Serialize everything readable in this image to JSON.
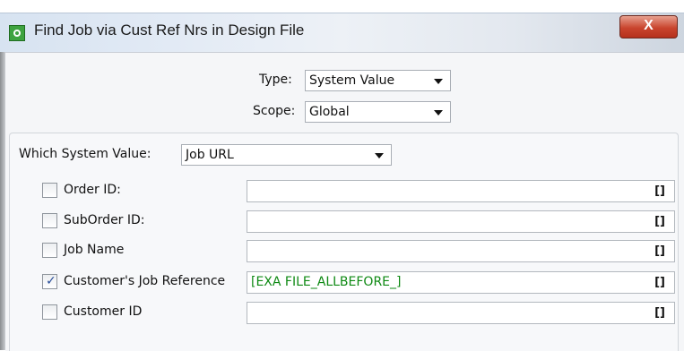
{
  "window": {
    "title": "Find Job via Cust Ref Nrs in Design File",
    "close_label": "X"
  },
  "type": {
    "label": "Type:",
    "value": "System Value"
  },
  "scope": {
    "label": "Scope:",
    "value": "Global"
  },
  "system_value": {
    "label": "Which System Value:",
    "value": "Job URL"
  },
  "fields": [
    {
      "label": "Order ID:",
      "checked": false,
      "value": "",
      "suffix": "[]"
    },
    {
      "label": "SubOrder ID:",
      "checked": false,
      "value": "",
      "suffix": "[]"
    },
    {
      "label": "Job Name",
      "checked": false,
      "value": "",
      "suffix": "[]"
    },
    {
      "label": "Customer's Job Reference",
      "checked": true,
      "value": "[EXA FILE_ALLBEFORE_]",
      "suffix": "[]"
    },
    {
      "label": "Customer ID",
      "checked": false,
      "value": "",
      "suffix": "[]"
    }
  ],
  "colors": {
    "value_text": "#0f8a14",
    "close_button": "#c9452e",
    "app_icon": "#3ea340"
  }
}
